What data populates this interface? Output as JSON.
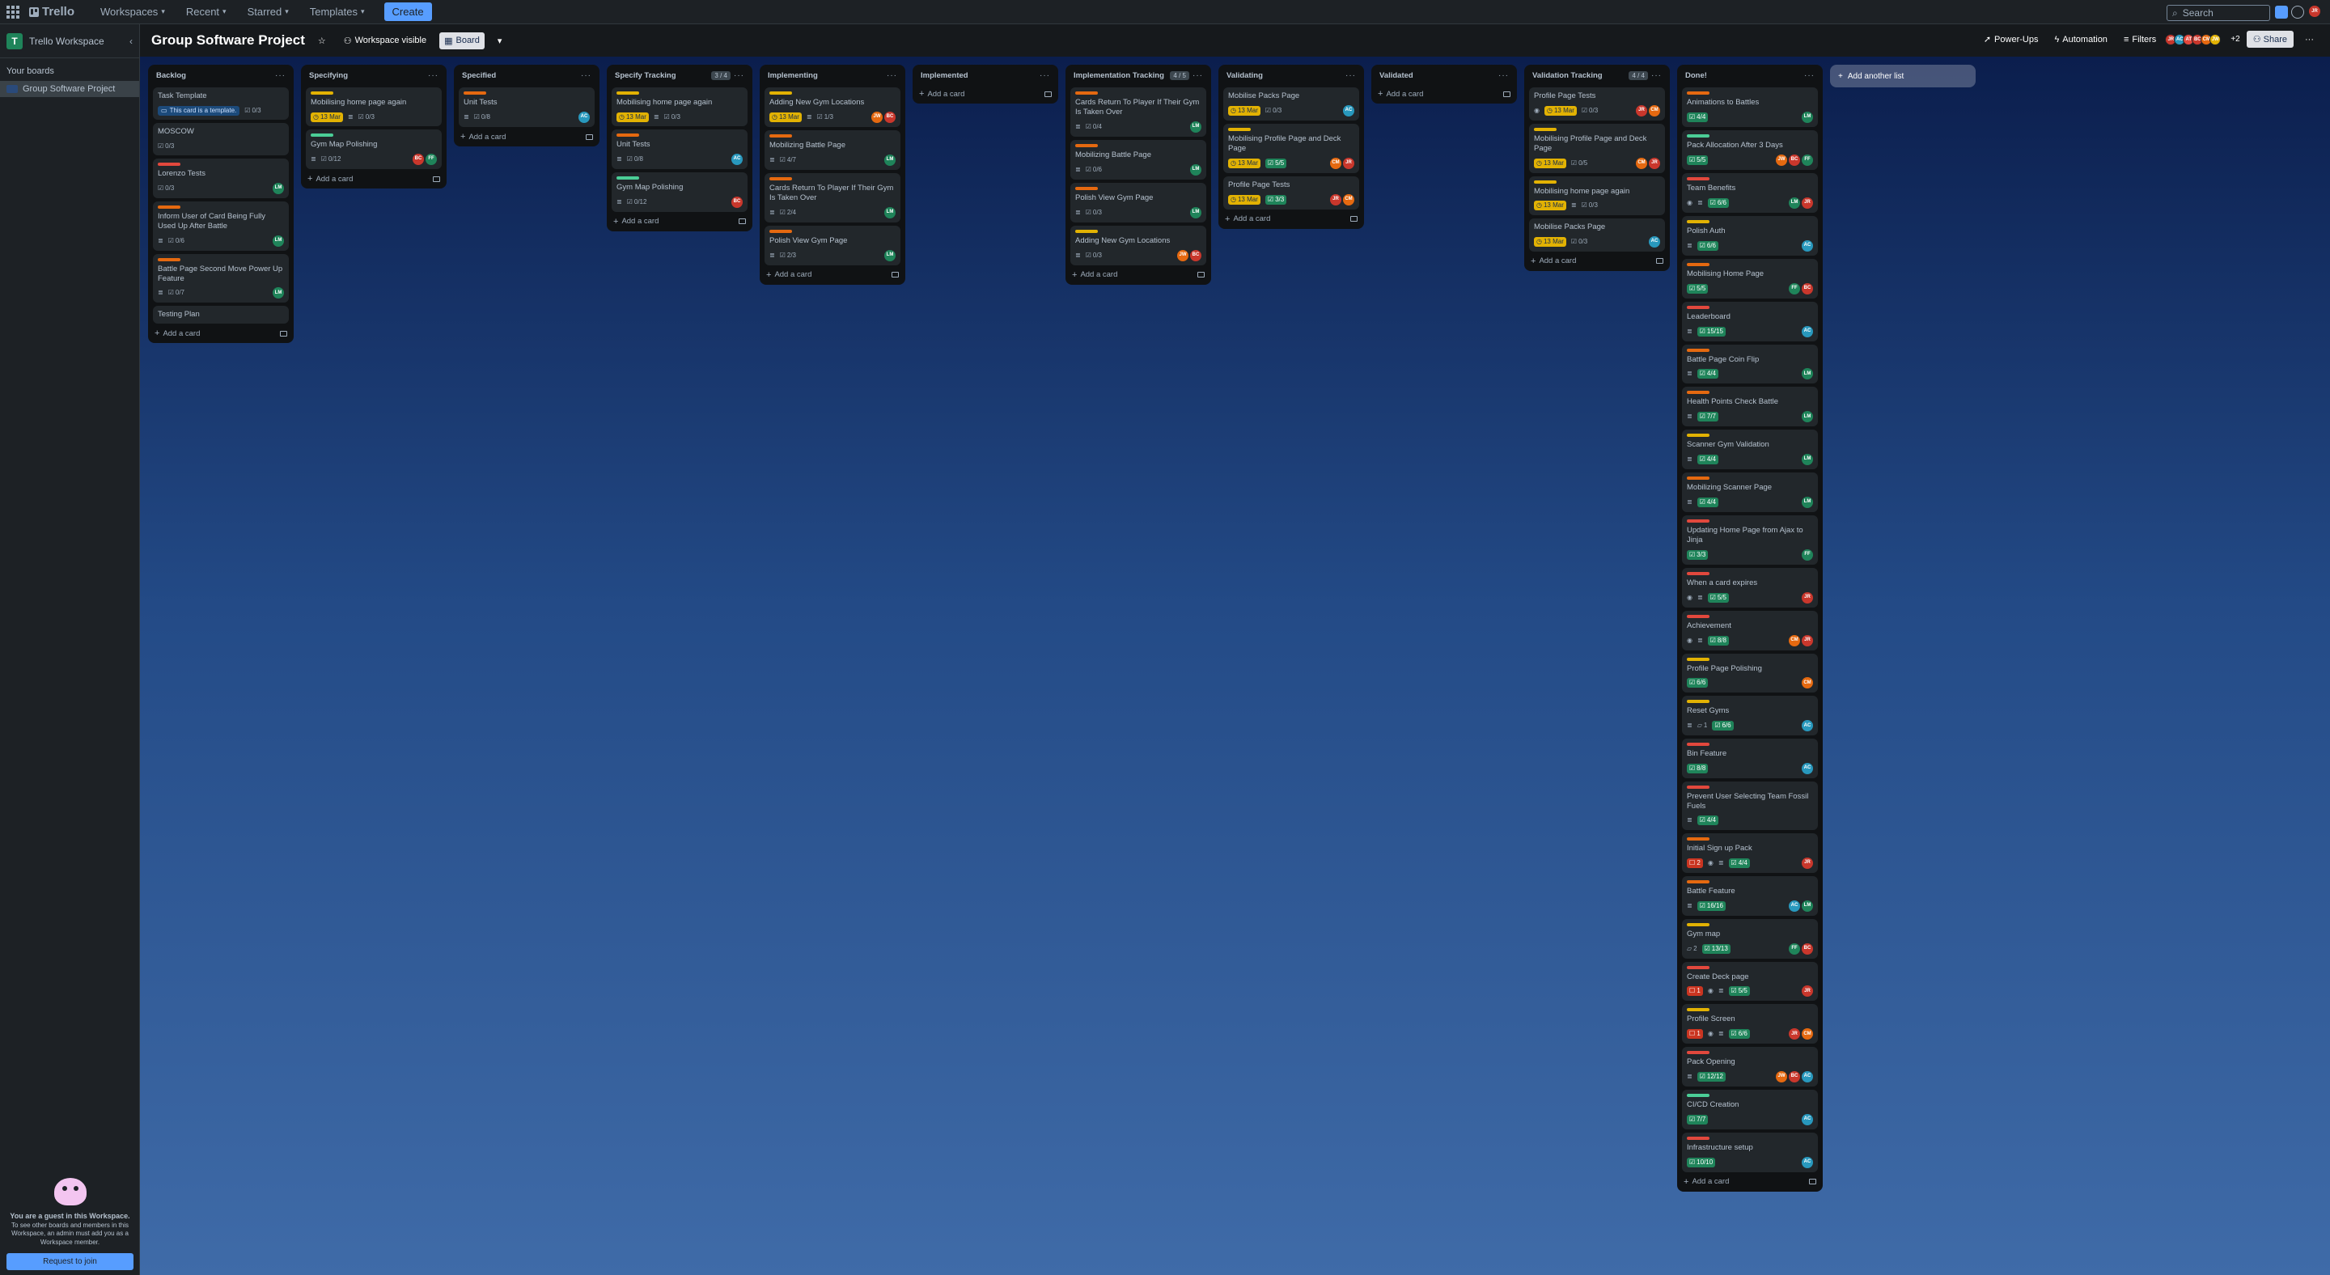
{
  "topbar": {
    "logo": "Trello",
    "nav": [
      "Workspaces",
      "Recent",
      "Starred",
      "Templates"
    ],
    "create": "Create",
    "search_placeholder": "Search",
    "user_initials": "JR"
  },
  "sidebar": {
    "workspace": "Trello Workspace",
    "workspace_initial": "T",
    "your_boards": "Your boards",
    "boards": [
      "Group Software Project"
    ],
    "guest_title": "You are a guest in this Workspace.",
    "guest_text": "To see other boards and members in this Workspace, an admin must add you as a Workspace member.",
    "join_button": "Request to join"
  },
  "header": {
    "title": "Group Software Project",
    "visibility": "Workspace visible",
    "view": "Board",
    "power_ups": "Power-Ups",
    "automation": "Automation",
    "filters": "Filters",
    "extra_members": "+2",
    "share": "Share",
    "members": [
      {
        "initials": "JR",
        "color": "#c9372c"
      },
      {
        "initials": "AC",
        "color": "#2898bd"
      },
      {
        "initials": "AT",
        "color": "#e2483d"
      },
      {
        "initials": "BC",
        "color": "#c9372c"
      },
      {
        "initials": "CM",
        "color": "#e56910"
      },
      {
        "initials": "JW",
        "color": "#e2b203"
      }
    ]
  },
  "add_list": "Add another list",
  "add_card": "Add a card",
  "lists": [
    {
      "title": "Backlog",
      "cards": [
        {
          "title": "Task Template",
          "template": "This card is a template.",
          "check": "0/3"
        },
        {
          "title": "MOSCOW",
          "check": "0/3"
        },
        {
          "title": "Lorenzo Tests",
          "label": "red",
          "check": "0/3",
          "members": [
            {
              "i": "LM",
              "c": "#1f845a"
            }
          ]
        },
        {
          "title": "Inform User of Card Being Fully Used Up After Battle",
          "label": "orange",
          "desc": true,
          "check": "0/6",
          "members": [
            {
              "i": "LM",
              "c": "#1f845a"
            }
          ]
        },
        {
          "title": "Battle Page Second Move Power Up Feature",
          "label": "orange",
          "desc": true,
          "check": "0/7",
          "members": [
            {
              "i": "LM",
              "c": "#1f845a"
            }
          ]
        },
        {
          "title": "Testing Plan"
        }
      ]
    },
    {
      "title": "Specifying",
      "cards": [
        {
          "title": "Mobilising home page again",
          "label": "yellow",
          "due": "13 Mar",
          "desc": true,
          "check": "0/3"
        },
        {
          "title": "Gym Map Polishing",
          "label": "green",
          "desc": true,
          "check": "0/12",
          "members": [
            {
              "i": "BC",
              "c": "#c9372c"
            },
            {
              "i": "FF",
              "c": "#1f845a"
            }
          ]
        }
      ]
    },
    {
      "title": "Specified",
      "cards": [
        {
          "title": "Unit Tests",
          "label": "orange",
          "desc": true,
          "check": "0/8",
          "members": [
            {
              "i": "AC",
              "c": "#2898bd"
            }
          ]
        }
      ]
    },
    {
      "title": "Specify Tracking",
      "count": "3 / 4",
      "cards": [
        {
          "title": "Mobilising home page again",
          "label": "yellow",
          "due": "13 Mar",
          "desc": true,
          "check": "0/3"
        },
        {
          "title": "Unit Tests",
          "label": "orange",
          "desc": true,
          "check": "0/8",
          "members": [
            {
              "i": "AC",
              "c": "#2898bd"
            }
          ]
        },
        {
          "title": "Gym Map Polishing",
          "label": "green",
          "desc": true,
          "check": "0/12",
          "members": [
            {
              "i": "BC",
              "c": "#c9372c"
            }
          ]
        }
      ]
    },
    {
      "title": "Implementing",
      "cards": [
        {
          "title": "Adding New Gym Locations",
          "label": "yellow",
          "due": "13 Mar",
          "desc": true,
          "check": "1/3",
          "members": [
            {
              "i": "JW",
              "c": "#e56910"
            },
            {
              "i": "BC",
              "c": "#c9372c"
            }
          ]
        },
        {
          "title": "Mobilizing Battle Page",
          "label": "orange",
          "desc": true,
          "check": "4/7",
          "members": [
            {
              "i": "LM",
              "c": "#1f845a"
            }
          ]
        },
        {
          "title": "Cards Return To Player If Their Gym Is Taken Over",
          "label": "orange",
          "desc": true,
          "check": "2/4",
          "members": [
            {
              "i": "LM",
              "c": "#1f845a"
            }
          ]
        },
        {
          "title": "Polish View Gym Page",
          "label": "orange",
          "desc": true,
          "check": "2/3",
          "members": [
            {
              "i": "LM",
              "c": "#1f845a"
            }
          ]
        }
      ]
    },
    {
      "title": "Implemented",
      "cards": []
    },
    {
      "title": "Implementation Tracking",
      "count": "4 / 5",
      "cards": [
        {
          "title": "Cards Return To Player If Their Gym Is Taken Over",
          "label": "orange",
          "desc": true,
          "check": "0/4",
          "members": [
            {
              "i": "LM",
              "c": "#1f845a"
            }
          ]
        },
        {
          "title": "Mobilizing Battle Page",
          "label": "orange",
          "desc": true,
          "check": "0/6",
          "members": [
            {
              "i": "LM",
              "c": "#1f845a"
            }
          ]
        },
        {
          "title": "Polish View Gym Page",
          "label": "orange",
          "desc": true,
          "check": "0/3",
          "members": [
            {
              "i": "LM",
              "c": "#1f845a"
            }
          ]
        },
        {
          "title": "Adding New Gym Locations",
          "label": "yellow",
          "desc": true,
          "check": "0/3",
          "members": [
            {
              "i": "JW",
              "c": "#e56910"
            },
            {
              "i": "BC",
              "c": "#c9372c"
            }
          ]
        }
      ]
    },
    {
      "title": "Validating",
      "cards": [
        {
          "title": "Mobilise Packs Page",
          "due": "13 Mar",
          "check": "0/3",
          "members": [
            {
              "i": "AC",
              "c": "#2898bd"
            }
          ]
        },
        {
          "title": "Mobilising Profile Page and Deck Page",
          "label": "yellow",
          "due": "13 Mar",
          "checkdone": "5/5",
          "members": [
            {
              "i": "CM",
              "c": "#e56910"
            },
            {
              "i": "JR",
              "c": "#c9372c"
            }
          ]
        },
        {
          "title": "Profile Page Tests",
          "due": "13 Mar",
          "checkdone": "3/3",
          "members": [
            {
              "i": "JR",
              "c": "#c9372c"
            },
            {
              "i": "CM",
              "c": "#e56910"
            }
          ]
        }
      ]
    },
    {
      "title": "Validated",
      "cards": []
    },
    {
      "title": "Validation Tracking",
      "count": "4 / 4",
      "cards": [
        {
          "title": "Profile Page Tests",
          "watch": true,
          "due": "13 Mar",
          "check": "0/3",
          "members": [
            {
              "i": "JR",
              "c": "#c9372c"
            },
            {
              "i": "CM",
              "c": "#e56910"
            }
          ]
        },
        {
          "title": "Mobilising Profile Page and Deck Page",
          "label": "yellow",
          "due": "13 Mar",
          "check": "0/5",
          "members": [
            {
              "i": "CM",
              "c": "#e56910"
            },
            {
              "i": "JR",
              "c": "#c9372c"
            }
          ]
        },
        {
          "title": "Mobilising home page again",
          "label": "yellow",
          "due": "13 Mar",
          "desc": true,
          "check": "0/3"
        },
        {
          "title": "Mobilise Packs Page",
          "due": "13 Mar",
          "check": "0/3",
          "members": [
            {
              "i": "AC",
              "c": "#2898bd"
            }
          ]
        }
      ]
    },
    {
      "title": "Done!",
      "cards": [
        {
          "title": "Animations to Battles",
          "label": "orange",
          "checkdone": "4/4",
          "members": [
            {
              "i": "LM",
              "c": "#1f845a"
            }
          ]
        },
        {
          "title": "Pack Allocation After 3 Days",
          "label": "green",
          "checkdone": "5/5",
          "members": [
            {
              "i": "JW",
              "c": "#e56910"
            },
            {
              "i": "BC",
              "c": "#c9372c"
            },
            {
              "i": "FF",
              "c": "#1f845a"
            }
          ]
        },
        {
          "title": "Team Benefits",
          "label": "red",
          "watch": true,
          "desc": true,
          "checkdone": "6/6",
          "members": [
            {
              "i": "LM",
              "c": "#1f845a"
            },
            {
              "i": "JR",
              "c": "#c9372c"
            }
          ]
        },
        {
          "title": "Polish Auth",
          "label": "yellow",
          "desc": true,
          "checkdone": "6/6",
          "members": [
            {
              "i": "AC",
              "c": "#2898bd"
            }
          ]
        },
        {
          "title": "Mobilising Home Page",
          "label": "orange",
          "checkdone": "5/5",
          "members": [
            {
              "i": "FF",
              "c": "#1f845a"
            },
            {
              "i": "BC",
              "c": "#c9372c"
            }
          ]
        },
        {
          "title": "Leaderboard",
          "label": "red",
          "desc": true,
          "checkdone": "15/15",
          "members": [
            {
              "i": "AC",
              "c": "#2898bd"
            }
          ]
        },
        {
          "title": "Battle Page Coin Flip",
          "label": "orange",
          "desc": true,
          "checkdone": "4/4",
          "members": [
            {
              "i": "LM",
              "c": "#1f845a"
            }
          ]
        },
        {
          "title": "Health Points Check Battle",
          "label": "orange",
          "desc": true,
          "checkdone": "7/7",
          "members": [
            {
              "i": "LM",
              "c": "#1f845a"
            }
          ]
        },
        {
          "title": "Scanner Gym Validation",
          "label": "yellow",
          "desc": true,
          "checkdone": "4/4",
          "members": [
            {
              "i": "LM",
              "c": "#1f845a"
            }
          ]
        },
        {
          "title": "Mobilizing Scanner Page",
          "label": "orange",
          "desc": true,
          "checkdone": "4/4",
          "members": [
            {
              "i": "LM",
              "c": "#1f845a"
            }
          ]
        },
        {
          "title": "Updating Home Page from Ajax to Jinja",
          "label": "red",
          "checkdone": "3/3",
          "members": [
            {
              "i": "FF",
              "c": "#1f845a"
            }
          ]
        },
        {
          "title": "When a card expires",
          "label": "red",
          "watch": true,
          "desc": true,
          "checkdone": "5/5",
          "members": [
            {
              "i": "JR",
              "c": "#c9372c"
            }
          ]
        },
        {
          "title": "Achievement",
          "label": "red",
          "watch": true,
          "desc": true,
          "checkdone": "8/8",
          "members": [
            {
              "i": "CM",
              "c": "#e56910"
            },
            {
              "i": "JR",
              "c": "#c9372c"
            }
          ]
        },
        {
          "title": "Profile Page Polishing",
          "label": "yellow",
          "checkdone": "6/6",
          "members": [
            {
              "i": "CM",
              "c": "#e56910"
            }
          ]
        },
        {
          "title": "Reset Gyms",
          "label": "yellow",
          "desc": true,
          "comments": "1",
          "checkdone": "6/6",
          "members": [
            {
              "i": "AC",
              "c": "#2898bd"
            }
          ]
        },
        {
          "title": "Bin Feature",
          "label": "red",
          "checkdone": "8/8",
          "members": [
            {
              "i": "AC",
              "c": "#2898bd"
            }
          ]
        },
        {
          "title": "Prevent User Selecting Team Fossil Fuels",
          "label": "red",
          "desc": true,
          "checkdone": "4/4"
        },
        {
          "title": "Initial Sign up Pack",
          "label": "orange",
          "alert": "2",
          "watch": true,
          "desc": true,
          "checkdone": "4/4",
          "members": [
            {
              "i": "JR",
              "c": "#c9372c"
            }
          ]
        },
        {
          "title": "Battle Feature",
          "label": "orange",
          "desc": true,
          "checkdone": "16/16",
          "members": [
            {
              "i": "AC",
              "c": "#2898bd"
            },
            {
              "i": "LM",
              "c": "#1f845a"
            }
          ]
        },
        {
          "title": "Gym map",
          "label": "yellow",
          "comments": "2",
          "checkdone": "13/13",
          "members": [
            {
              "i": "FF",
              "c": "#1f845a"
            },
            {
              "i": "BC",
              "c": "#c9372c"
            }
          ]
        },
        {
          "title": "Create Deck page",
          "label": "red",
          "alert": "1",
          "watch": true,
          "desc": true,
          "checkdone": "5/5",
          "members": [
            {
              "i": "JR",
              "c": "#c9372c"
            }
          ]
        },
        {
          "title": "Profile Screen",
          "label": "yellow",
          "alert": "1",
          "watch": true,
          "desc": true,
          "checkdone": "6/6",
          "members": [
            {
              "i": "JR",
              "c": "#c9372c"
            },
            {
              "i": "CM",
              "c": "#e56910"
            }
          ]
        },
        {
          "title": "Pack Opening",
          "label": "red",
          "desc": true,
          "checkdone": "12/12",
          "members": [
            {
              "i": "JW",
              "c": "#e56910"
            },
            {
              "i": "BC",
              "c": "#c9372c"
            },
            {
              "i": "AC",
              "c": "#2898bd"
            }
          ]
        },
        {
          "title": "CI/CD Creation",
          "label": "green",
          "checkdone": "7/7",
          "members": [
            {
              "i": "AC",
              "c": "#2898bd"
            }
          ]
        },
        {
          "title": "Infrastructure setup",
          "label": "red",
          "checkdone": "10/10",
          "members": [
            {
              "i": "AC",
              "c": "#2898bd"
            }
          ]
        }
      ]
    }
  ]
}
